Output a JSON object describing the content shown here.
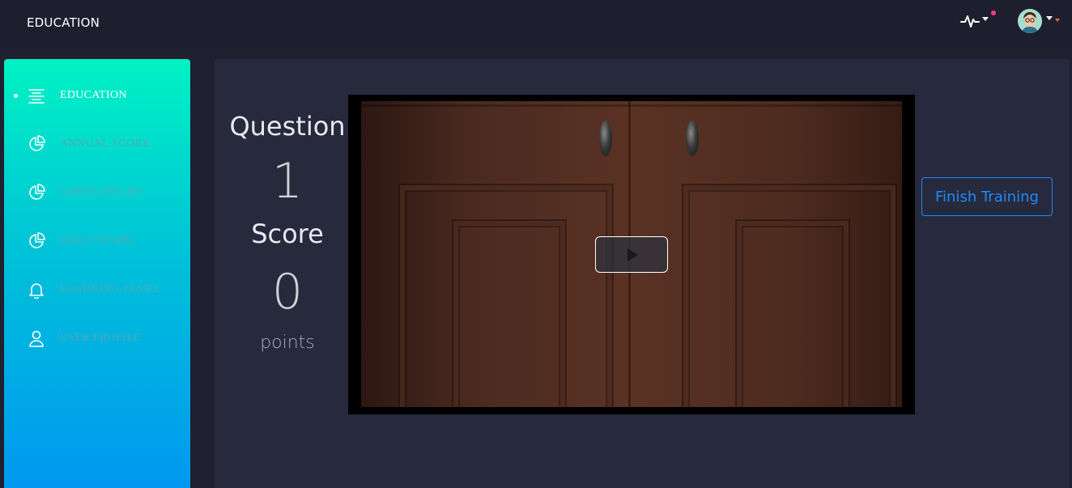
{
  "header": {
    "title": "EDUCATION",
    "icons": [
      "activity-icon",
      "chevron-down-icon",
      "notification-dot",
      "avatar",
      "chevron-down-icon"
    ],
    "notification_color": "#ff3e7f"
  },
  "sidebar": {
    "gradient": [
      "#00f2c3",
      "#0098f0"
    ],
    "items": [
      {
        "label": "EDUCATION",
        "icon": "align-center-icon",
        "active": true
      },
      {
        "label": "ANNUAL SCORE",
        "icon": "pie-chart-icon",
        "active": false
      },
      {
        "label": "GREEN FIELDS",
        "icon": "pie-chart-icon",
        "active": false
      },
      {
        "label": "DAILY WORK",
        "icon": "pie-chart-icon",
        "active": false
      },
      {
        "label": "LEARNING LEVEL",
        "icon": "bell-icon",
        "active": false
      },
      {
        "label": "USER PROFILE",
        "icon": "user-icon",
        "active": false
      }
    ]
  },
  "main": {
    "question_label": "Question",
    "question_value": "1",
    "score_label": "Score",
    "score_value": "0",
    "score_unit": "points",
    "video": {
      "control": "play-icon"
    },
    "finish_button": "Finish Training",
    "accent": "#1d8cf8"
  }
}
